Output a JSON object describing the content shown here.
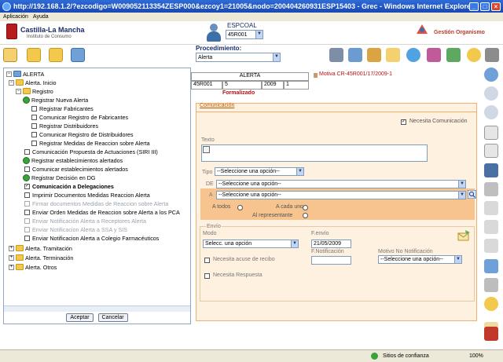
{
  "window": {
    "title": "http://192.168.1.2/?ezcodigo=W009052113354ZESP000&ezcoy1=21005&nodo=200404260931ESP15403 - Grec - Windows Internet Explorer"
  },
  "menu": [
    "Aplicación",
    "Ayuda"
  ],
  "header": {
    "logo_title": "Castilla-La Mancha",
    "logo_subtitle": "Instituto de Consumo",
    "espcoal_label": "ESPCOAL",
    "espcoal_value": "45R001",
    "gestion_label": "Gestión Organismo"
  },
  "procedure": {
    "label": "Procedimiento:",
    "value": "Alerta"
  },
  "alerta_header": {
    "title": "ALERTA",
    "code": "45R001",
    "number": "5",
    "year": "2009",
    "index": "1",
    "status": "Formalizado",
    "motiva": "Motiva CR-45R001/17/2009-1"
  },
  "tree": {
    "root": "ALERTA",
    "alerta_inicio": "Alerta. Inicio",
    "registro": "Registro",
    "registro_items": [
      "Registrar Nueva Alerta",
      "Registrar Fabricantes",
      "Comunicar Registro de Fabricantes",
      "Registrar Distribuidores",
      "Comunicar Registro de Distribuidores",
      "Registrar Medidas de Reaccion sobre Alerta"
    ],
    "items": [
      "Comunicación Propuesta de Actuaciones (SIRI III)",
      "Registrar establecimientos alertados",
      "Comunicar establecimientos alertados",
      "Registrar Decisión en DG",
      "Comunicación a Delegaciones",
      "Imprimir Documentos Medidas Reaccion Alerta",
      "Firmar documentos Medidas de Reaccion sobre Alerta",
      "Enviar Orden Medidas de Reaccion sobre Alerta a los PCA",
      "Enviar Notificación Alerta a Receptores Alerta",
      "Enviar Notificacion Alerta a SSA y SIS",
      "Enviar Notificacion Alerta a Colegio Farmacéuticos"
    ],
    "tramitacion": "Alerta. Tramitación",
    "terminacion": "Alerta. Terminación",
    "otros": "Alerta. Otros",
    "accept": "Aceptar",
    "cancel": "Cancelar"
  },
  "comunicacion": {
    "tab": "Comunicación",
    "necesita_comunicacion": "Necesita Comunicación",
    "texto_label": "Texto",
    "tipo_label": "Tipo",
    "tipo_value": "--Seleccione una opción--",
    "de_label": "DE",
    "de_value": "--Seleccione una opción--",
    "a_label": "A",
    "a_value": "--Seleccione una opción--",
    "a_todos": "A todos",
    "a_cada_uno": "A cada uno",
    "al_representante": "Al representante",
    "envio_label": "Envío",
    "modo_label": "Modo",
    "modo_value": "Selecc. una opción",
    "fenvio_label": "F.envío",
    "fenvio_value": "21/05/2009",
    "acuse_label": "Necesita acuse de recibo",
    "fnotificacion_label": "F.Notificación",
    "motivo_label": "Motivo No Notificación",
    "motivo_value": "--Seleccione una opción--",
    "respuesta_label": "Necesita Respuesta"
  },
  "status": {
    "zone": "Sitios de confianza",
    "zoom": "100%"
  },
  "colors": {
    "accent": "#1a2c6b",
    "alert_red": "#b11111",
    "panel_bg": "#fff1df",
    "tree_border": "#8fa8c8"
  }
}
